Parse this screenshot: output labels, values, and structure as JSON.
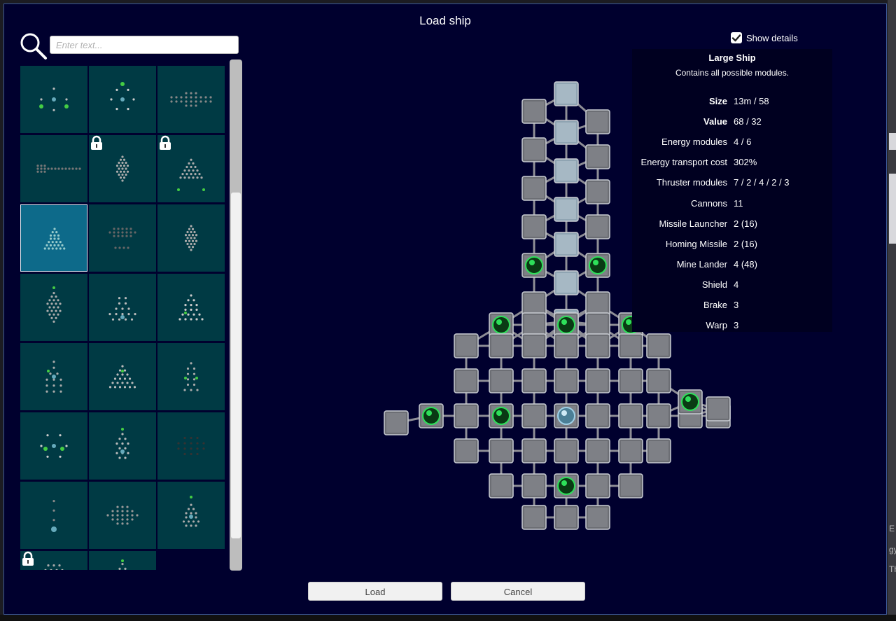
{
  "dialog": {
    "title": "Load ship"
  },
  "search": {
    "placeholder": "Enter text..."
  },
  "details_toggle": {
    "label": "Show details",
    "checked": true
  },
  "ship": {
    "name": "Large Ship",
    "description": "Contains all possible modules.",
    "stats": [
      {
        "key": "Size",
        "value": "13m / 58",
        "bold": true
      },
      {
        "key": "Value",
        "value": "68 / 32",
        "bold": true
      },
      {
        "key": "Energy modules",
        "value": "4 / 6",
        "bold": false
      },
      {
        "key": "Energy transport cost",
        "value": "302%",
        "bold": false
      },
      {
        "key": "Thruster modules",
        "value": "7 / 2 / 4 / 2 / 3",
        "bold": false
      },
      {
        "key": "Cannons",
        "value": "11",
        "bold": false
      },
      {
        "key": "Missile Launcher",
        "value": "2 (16)",
        "bold": false
      },
      {
        "key": "Homing Missile",
        "value": "2 (16)",
        "bold": false
      },
      {
        "key": "Mine Lander",
        "value": "4 (48)",
        "bold": false
      },
      {
        "key": "Shield",
        "value": "4",
        "bold": false
      },
      {
        "key": "Brake",
        "value": "3",
        "bold": false
      },
      {
        "key": "Warp",
        "value": "3",
        "bold": false
      }
    ]
  },
  "ship_list": {
    "selected_index": 6,
    "locked_indices": [
      4,
      5,
      21
    ],
    "count": 23
  },
  "buttons": {
    "load": "Load",
    "cancel": "Cancel"
  },
  "colors": {
    "dialog_bg": "#00002e",
    "cell_bg": "#003a44",
    "cell_selected": "#0d6a8a",
    "module_green": "#2ee05a"
  },
  "background_fragments": {
    "side_letters": [
      "E",
      "gy",
      "Th"
    ]
  }
}
